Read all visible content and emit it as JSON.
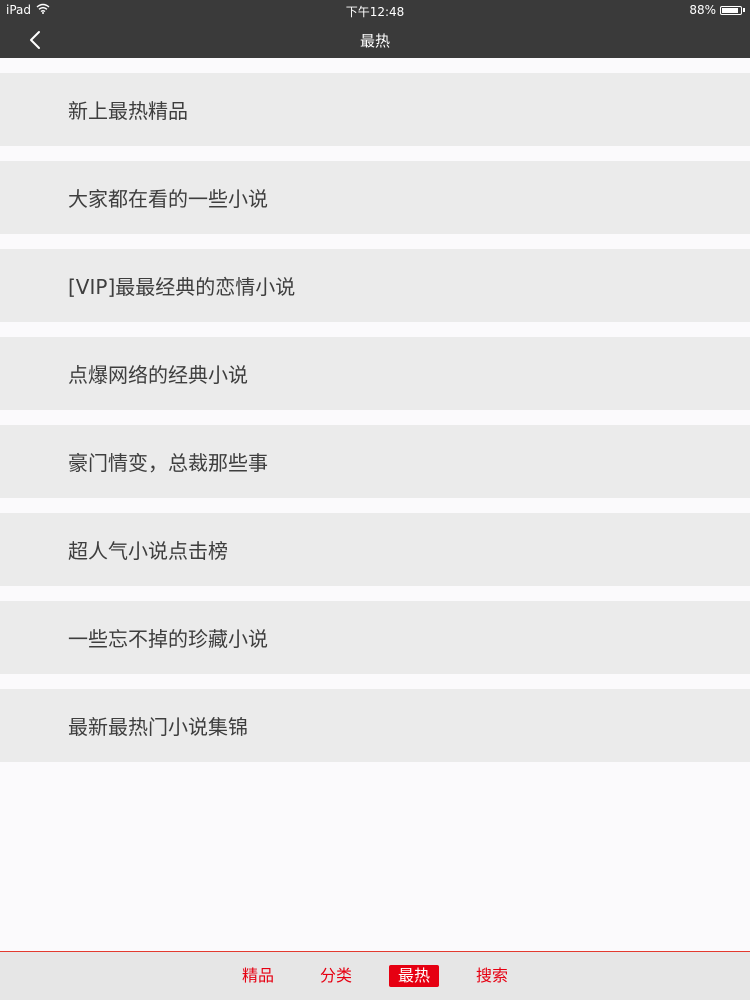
{
  "status_bar": {
    "device": "iPad",
    "time": "下午12:48",
    "battery": "88%",
    "battery_level": 0.88,
    "wifi_icon": "wifi-icon"
  },
  "nav": {
    "title": "最热",
    "back_icon": "chevron-left-icon"
  },
  "items": [
    "新上最热精品",
    "大家都在看的一些小说",
    "[VIP]最最经典的恋情小说",
    "点爆网络的经典小说",
    "豪门情变，总裁那些事",
    "超人气小说点击榜",
    "一些忘不掉的珍藏小说",
    "最新最热门小说集锦"
  ],
  "tabs": [
    {
      "label": "精品",
      "active": false
    },
    {
      "label": "分类",
      "active": false
    },
    {
      "label": "最热",
      "active": true
    },
    {
      "label": "搜索",
      "active": false
    }
  ],
  "colors": {
    "bar_background": "#3a3a3a",
    "accent": "#e60012",
    "list_item_background": "#ebebeb",
    "page_background": "#fbfafc"
  }
}
